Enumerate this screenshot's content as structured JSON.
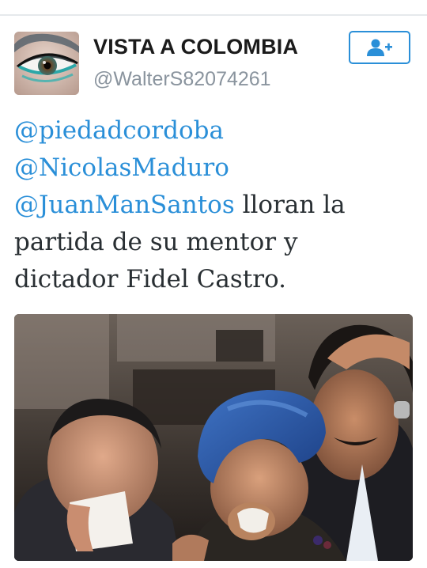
{
  "tweet": {
    "display_name": "VISTA A COLOMBIA",
    "handle": "@WalterS82074261",
    "avatar_icon": "eye-makeup-avatar",
    "follow_icon": "add-user-icon",
    "text_lines": [
      {
        "mention": "@piedadcordoba",
        "text": ""
      },
      {
        "mention": "@NicolasMaduro",
        "text": ""
      },
      {
        "mention": "@JuanManSantos",
        "text": " lloran la"
      },
      {
        "mention": "",
        "text": "partida de su mentor y"
      },
      {
        "mention": "",
        "text": "dictador Fidel Castro."
      }
    ],
    "media_icon": "mourners-photo"
  },
  "colors": {
    "accent": "#2a8fd8",
    "text": "#292f33",
    "secondary": "#8a949e"
  }
}
